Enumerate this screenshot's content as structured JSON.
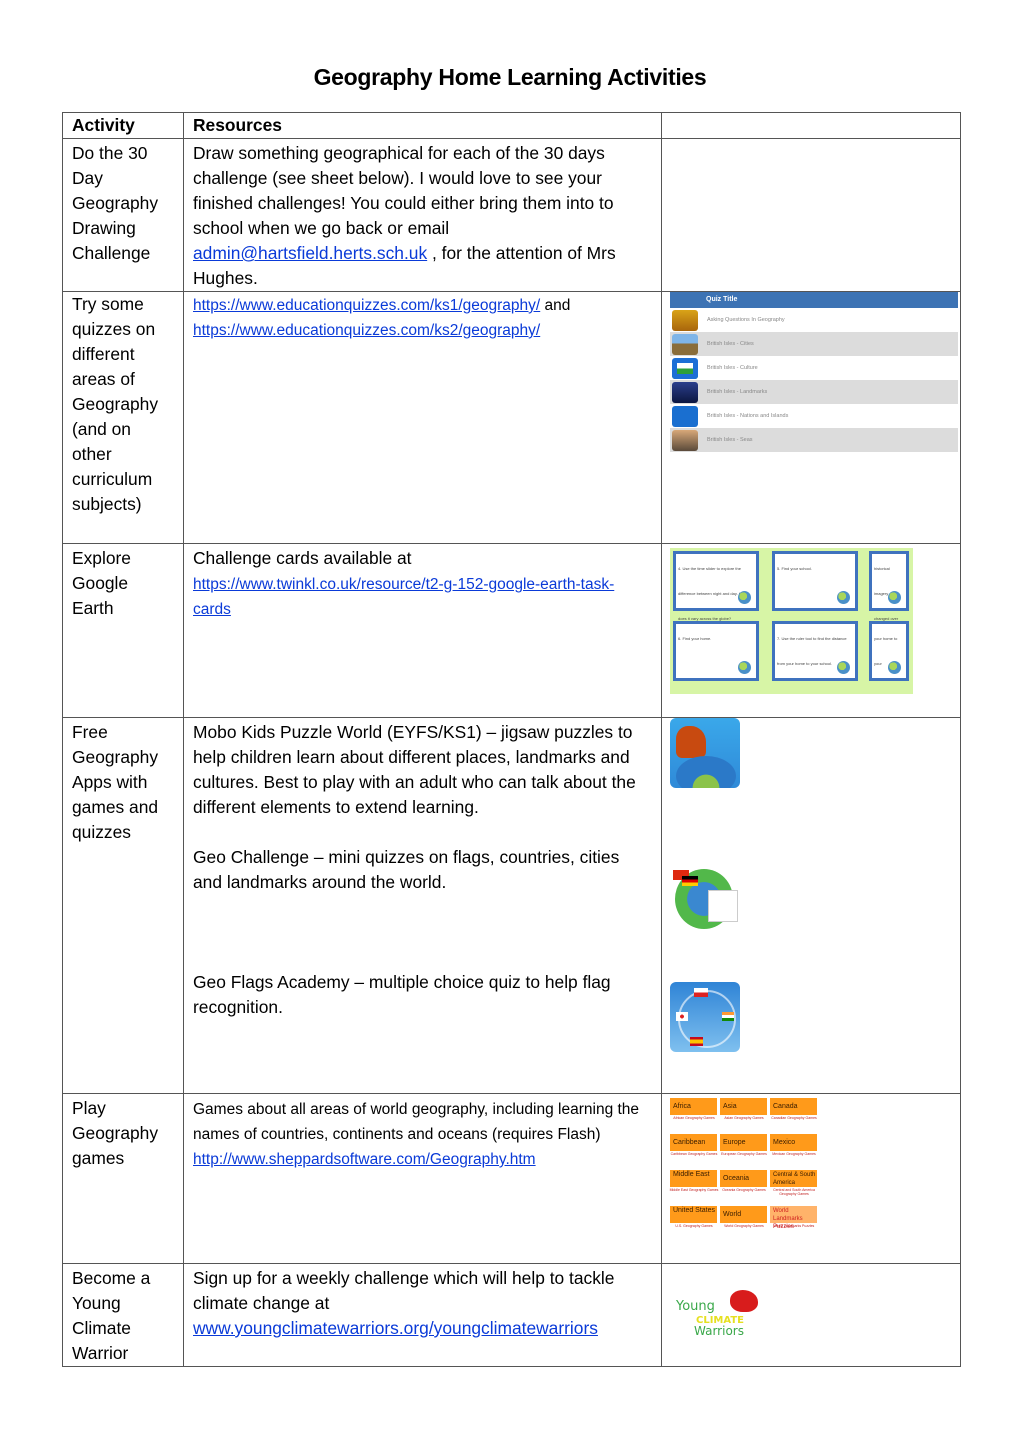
{
  "title": "Geography Home Learning Activities",
  "table": {
    "headers": [
      "Activity",
      "Resources",
      ""
    ],
    "rows": [
      {
        "activity": "Do the 30 Day Geography Drawing Challenge",
        "text1": "Draw something geographical for each of the 30 days challenge (see sheet below). I would love to see your finished challenges! You could either bring them into to school when we go back or email",
        "email": "admin@hartsfield.herts.sch.uk",
        "text2": " , for the attention of Mrs Hughes."
      },
      {
        "activity": "Try some quizzes on different areas of Geography (and on other curriculum subjects)",
        "link1": "https://www.educationquizzes.com/ks1/geography/",
        "joiner": " and",
        "link2": "https://www.educationquizzes.com/ks2/geography/",
        "image": {
          "header": "Quiz Title",
          "items": [
            "Asking Questions In Geography",
            "British Isles - Cities",
            "British Isles - Culture",
            "British Isles - Landmarks",
            "British Isles - Nations and Islands",
            "British Isles - Seas"
          ]
        }
      },
      {
        "activity": "Explore Google Earth",
        "text": "Challenge cards available at",
        "link": "https://www.twinkl.co.uk/resource/t2-g-152-google-earth-task-cards",
        "image": {
          "cards": [
            "4. Use the time slider to explore the difference between night and day. How does it vary across the globe?",
            "5. Find your school.",
            "historical imagery changed over the",
            "6. Find your home.",
            "7. Use the ruler tool to find the distance from your home to your school.",
            "your home to your"
          ]
        }
      },
      {
        "activity": "Free Geography Apps with games and quizzes",
        "apps": [
          {
            "name": "Mobo Kids Puzzle World",
            "text": "Mobo Kids Puzzle World (EYFS/KS1) – jigsaw puzzles to help children learn about different places, landmarks and cultures. Best to play with an adult who can talk about the different elements to extend learning."
          },
          {
            "name": "Geo Challenge",
            "text": "Geo Challenge – mini quizzes on flags, countries, cities and landmarks around the world."
          },
          {
            "name": "Geo Flags Academy",
            "text": "Geo Flags Academy – multiple choice quiz to help flag recognition."
          }
        ]
      },
      {
        "activity": "Play Geography games",
        "text": "Games  about all areas of world geography, including learning the names of countries, continents and oceans (requires Flash)",
        "link": "http://www.sheppardsoftware.com/Geography.htm",
        "image": {
          "tiles": [
            {
              "label": "Africa",
              "caption": "African Geography Games"
            },
            {
              "label": "Asia",
              "caption": "Asian Geography Games"
            },
            {
              "label": "Canada",
              "caption": "Canadian Geography Games"
            },
            {
              "label": "Caribbean",
              "caption": "Caribbean Geography Games"
            },
            {
              "label": "Europe",
              "caption": "European Geography Games"
            },
            {
              "label": "Mexico",
              "caption": "Mexican Geography Games"
            },
            {
              "label": "Middle East",
              "caption": "Middle East Geography Games"
            },
            {
              "label": "Oceania",
              "caption": "Oceania Geography Games"
            },
            {
              "label": "Central & South America",
              "caption": "Central and South America Geography Games"
            },
            {
              "label": "United States",
              "caption": "U.S. Geography Games"
            },
            {
              "label": "World",
              "caption": "World Geography Games"
            },
            {
              "label": "World Landmarks Puzzles",
              "caption": "World Landmarks Puzzles"
            }
          ]
        }
      },
      {
        "activity": "Become a Young Climate Warrior",
        "text": "Sign up for a weekly challenge which will help to tackle climate change at",
        "link": "www.youngclimatewarriors.org/youngclimatewarriors",
        "logo": {
          "line1": "Young",
          "line2": "CLIMATE",
          "line3": "Warriors"
        }
      }
    ]
  }
}
